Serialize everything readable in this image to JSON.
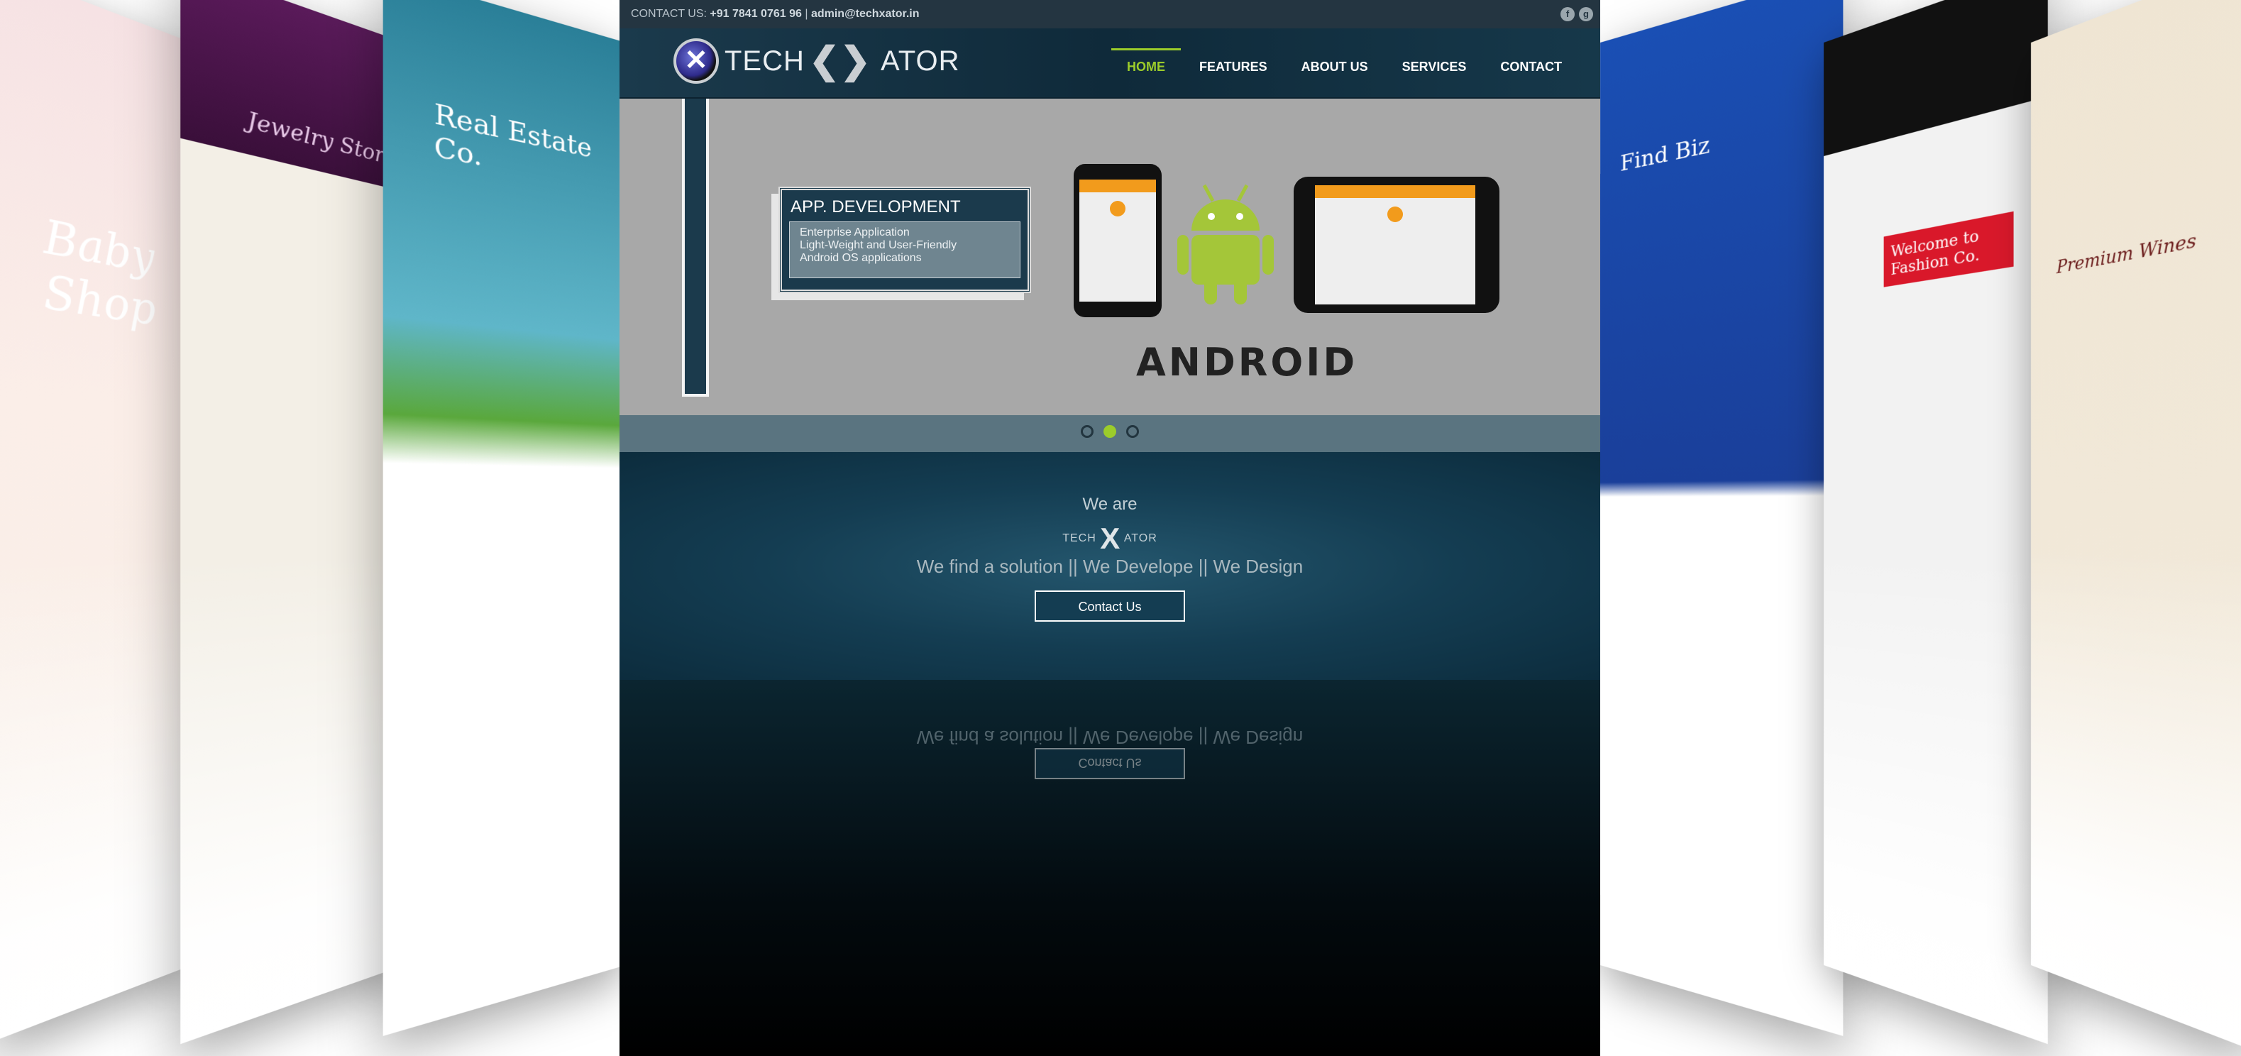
{
  "topbar": {
    "contact_prefix": "CONTACT US:",
    "phone": "+91 7841 0761 96",
    "separator": "|",
    "email": "admin@techxator.in"
  },
  "logo": {
    "left_text": "TECH",
    "right_text": "ATOR"
  },
  "nav": {
    "items": [
      {
        "label": "HOME",
        "active": true
      },
      {
        "label": "FEATURES"
      },
      {
        "label": "ABOUT US"
      },
      {
        "label": "SERVICES"
      },
      {
        "label": "CONTACT"
      }
    ]
  },
  "slide": {
    "title": "APP. DEVELOPMENT",
    "features": [
      "Enterprise Application",
      "Light-Weight and User-Friendly",
      "Android OS applications"
    ],
    "brand_word": "ANDROID",
    "dots_count": 3,
    "active_dot": 2
  },
  "hero": {
    "intro": "We are",
    "logo_left": "TECH",
    "logo_right": "ATOR",
    "tagline": "We find a solution || We Develope || We Design",
    "button": "Contact Us"
  },
  "side_panels": {
    "baby": "Baby Shop",
    "jewelry": "Jewelry Store",
    "real_estate": "Real Estate Co.",
    "find_biz": "Find Biz",
    "fashion": "Welcome to Fashion Co.",
    "wine": "Premium Wines"
  },
  "colors": {
    "accent": "#9ccc2a",
    "header_bg": "#1b3a4c",
    "hero_bg": "#143d52"
  }
}
